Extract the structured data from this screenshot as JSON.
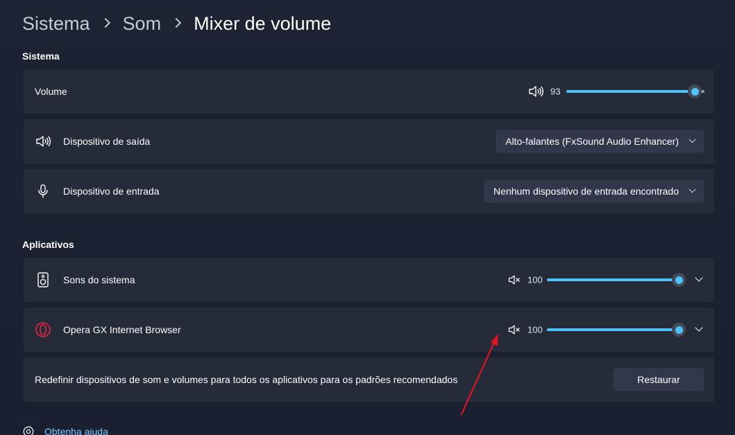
{
  "breadcrumb": {
    "items": [
      "Sistema",
      "Som"
    ],
    "current": "Mixer de volume"
  },
  "sistema": {
    "section_title": "Sistema",
    "volume": {
      "label": "Volume",
      "icon": "speaker-icon",
      "value": "93",
      "level": 93
    },
    "output": {
      "label": "Dispositivo de saída",
      "icon": "speaker-icon",
      "selected": "Alto-falantes (FxSound Audio Enhancer)"
    },
    "input": {
      "label": "Dispositivo de entrada",
      "icon": "microphone-icon",
      "selected": "Nenhum dispositivo de entrada encontrado"
    }
  },
  "aplicativos": {
    "section_title": "Aplicativos",
    "apps": [
      {
        "label": "Sons do sistema",
        "icon": "system-sounds-icon",
        "value": "100",
        "level": 100,
        "mute_icon": "speaker-muted-icon"
      },
      {
        "label": "Opera GX Internet Browser",
        "icon": "opera-gx-icon",
        "value": "100",
        "level": 100,
        "mute_icon": "speaker-muted-icon"
      }
    ],
    "reset": {
      "label": "Redefinir dispositivos de som e volumes para todos os aplicativos para os padrões recomendados",
      "button": "Restaurar"
    }
  },
  "help": {
    "label": "Obtenha ajuda",
    "icon": "help-icon"
  },
  "colors": {
    "accent": "#4cc2ff",
    "annotation_arrow": "#e0141e"
  }
}
